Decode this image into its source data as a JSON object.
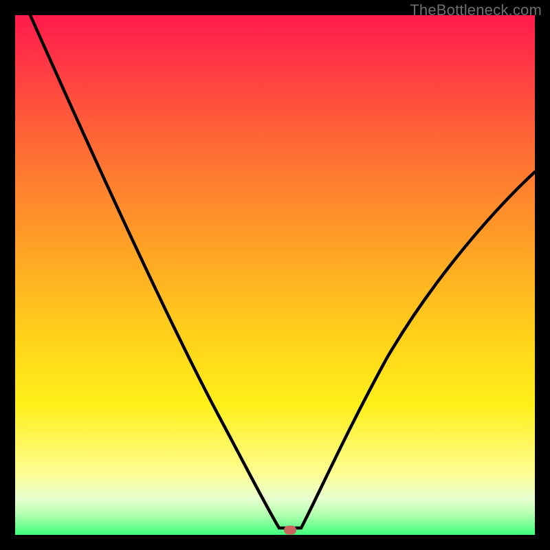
{
  "watermark": "TheBottleneck.com",
  "frame": {
    "border_color": "#000000",
    "border_px": 22,
    "gradient_stops": [
      {
        "pos": 0.0,
        "color": "#ff1a4b"
      },
      {
        "pos": 0.1,
        "color": "#ff3a44"
      },
      {
        "pos": 0.25,
        "color": "#ff6a35"
      },
      {
        "pos": 0.45,
        "color": "#ffa325"
      },
      {
        "pos": 0.62,
        "color": "#ffd21a"
      },
      {
        "pos": 0.75,
        "color": "#fff01a"
      },
      {
        "pos": 0.88,
        "color": "#fdfd90"
      },
      {
        "pos": 0.93,
        "color": "#e8ffd0"
      },
      {
        "pos": 0.96,
        "color": "#b5ffb0"
      },
      {
        "pos": 1.0,
        "color": "#3dff7a"
      }
    ]
  },
  "chart_data": {
    "type": "line",
    "title": "",
    "xlabel": "",
    "ylabel": "",
    "xlim": [
      0,
      100
    ],
    "ylim": [
      0,
      100
    ],
    "grid": false,
    "series": [
      {
        "name": "left-branch",
        "x": [
          3,
          10,
          18,
          26,
          33,
          39,
          44,
          47.5,
          49.5,
          50.8
        ],
        "y": [
          100,
          84,
          68,
          52,
          38,
          25,
          14,
          7,
          3,
          1
        ]
      },
      {
        "name": "right-branch",
        "x": [
          55,
          57,
          60,
          64,
          69,
          75,
          82,
          90,
          100
        ],
        "y": [
          1,
          4,
          9,
          17,
          27,
          38,
          49,
          59,
          70
        ]
      }
    ],
    "floor_segment": {
      "x": [
        50.8,
        55
      ],
      "y": [
        1,
        1
      ]
    },
    "marker": {
      "x": 53,
      "y": 1,
      "color": "#c9675e",
      "shape": "rounded-rect"
    }
  }
}
